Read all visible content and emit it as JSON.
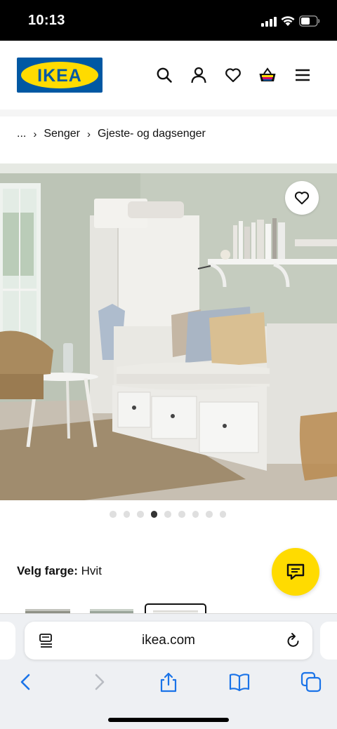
{
  "status_bar": {
    "time": "10:13"
  },
  "header": {
    "logo_text": "IKEA",
    "icons": [
      "search-icon",
      "account-icon",
      "heart-icon",
      "basket-icon",
      "menu-icon"
    ]
  },
  "breadcrumb": {
    "ellipsis": "...",
    "separator": "›",
    "items": [
      "Senger",
      "Gjeste- og dagsenger"
    ]
  },
  "gallery": {
    "dot_count": 9,
    "active_dot_index": 3
  },
  "color_select": {
    "label": "Velg farge:",
    "value": "Hvit"
  },
  "safari": {
    "url": "ikea.com"
  },
  "colors": {
    "ikea_blue": "#0058a3",
    "ikea_yellow": "#ffdb00",
    "status_bar": "#000000"
  }
}
